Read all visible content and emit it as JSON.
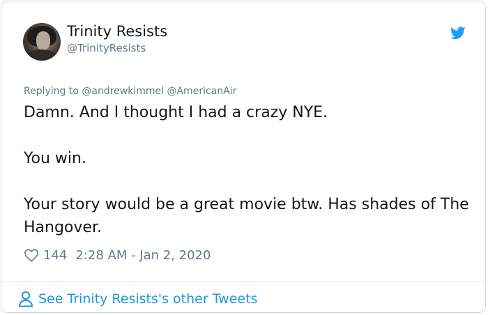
{
  "tweet": {
    "author_name": "Trinity Resists",
    "author_handle": "@TrinityResists",
    "replying_prefix": "Replying to",
    "replying_to": [
      "@andrewkimmel",
      "@AmericanAir"
    ],
    "paragraphs": [
      "Damn. And I thought I had a crazy NYE.",
      "You win.",
      "Your story would be a great movie btw. Has shades of The Hangover."
    ],
    "like_count": "144",
    "timestamp": "2:28 AM - Jan 2, 2020",
    "footer_link": "See Trinity Resists's other Tweets"
  },
  "icons": {
    "brand": "twitter-bird-icon",
    "like": "heart-icon",
    "profile": "person-icon"
  },
  "colors": {
    "brand_blue": "#1da1f2",
    "link_blue": "#1b95e0",
    "text_primary": "#14171a",
    "text_secondary": "#657786",
    "border": "#cfd9de"
  }
}
